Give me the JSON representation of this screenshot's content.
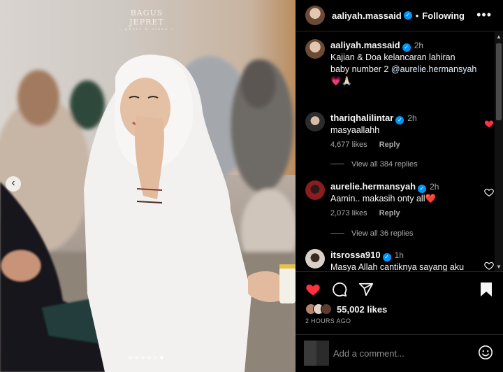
{
  "photo": {
    "watermark": "BAGUS JEPRET",
    "watermark_sub": "~ photo & video ~",
    "prev_glyph": "‹",
    "slide_count": 6,
    "active_slide": 5
  },
  "header": {
    "username": "aaliyah.massaid",
    "separator": "•",
    "follow_status": "Following",
    "more_glyph": "•••"
  },
  "caption": {
    "username": "aaliyah.massaid",
    "time": "2h",
    "text_line1": "Kajian & Doa kelancaran lahiran",
    "text_line2": "baby number 2",
    "mention": "@aurelie.hermansyah",
    "emoji": "💗🙏🏻"
  },
  "comments": [
    {
      "username": "thariqhalilintar",
      "time": "2h",
      "text": "masyaallahh",
      "likes": "4,677 likes",
      "reply": "Reply",
      "liked": true,
      "avatar_color": "#2c2c2c",
      "view_replies": "View all 384 replies"
    },
    {
      "username": "aurelie.hermansyah",
      "time": "2h",
      "text": "Aamin.. makasih onty all❤️",
      "likes": "2,073 likes",
      "reply": "Reply",
      "liked": false,
      "avatar_color": "#8a1c22",
      "view_replies": "View all 36 replies"
    },
    {
      "username": "itsrossa910",
      "time": "1h",
      "text": "Masya Allah cantiknya sayang aku",
      "liked": false,
      "avatar_color": "#d9d0c7"
    }
  ],
  "actions": {
    "likes_count": "55,002 likes",
    "posted": "2 HOURS AGO",
    "icons": [
      "heart-icon",
      "comment-icon",
      "share-icon",
      "bookmark-icon"
    ]
  },
  "add_comment": {
    "placeholder": "Add a comment..."
  },
  "colors": {
    "liked_red": "#ff3040",
    "verified_blue": "#0095f6",
    "secondary_text": "#a8a8a8"
  }
}
